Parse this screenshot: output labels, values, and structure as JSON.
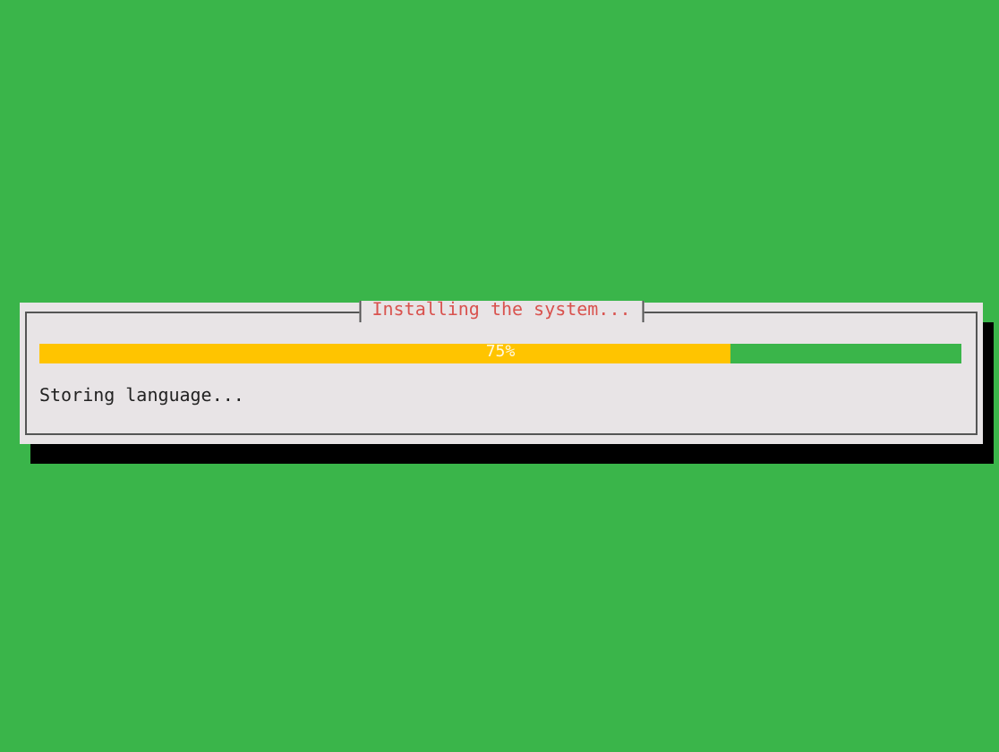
{
  "dialog": {
    "title": "Installing the system...",
    "progress": {
      "level": 0.75,
      "reading": "75%"
    },
    "status": "Storing language..."
  }
}
